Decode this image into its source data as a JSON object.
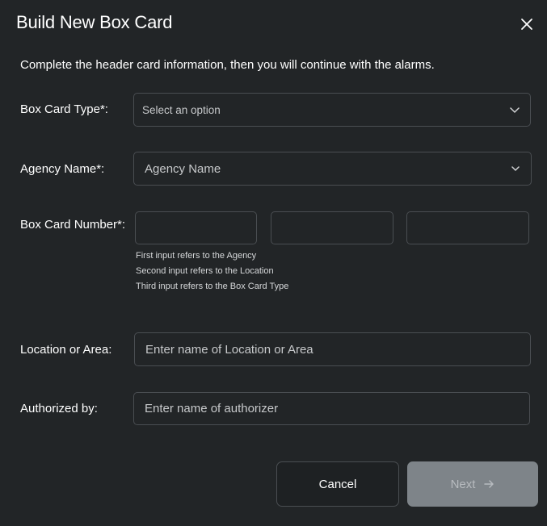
{
  "dialog": {
    "title": "Build New Box Card",
    "intro": "Complete the header card information, then you will continue with the alarms."
  },
  "form": {
    "box_card_type": {
      "label": "Box Card Type*:",
      "value": "Select an option"
    },
    "agency_name": {
      "label": "Agency Name*:",
      "value": "Agency Name"
    },
    "box_card_number": {
      "label": "Box Card Number*:",
      "hints": [
        "First input refers to the Agency",
        "Second input refers to the Location",
        "Third input refers to the Box Card Type"
      ]
    },
    "location": {
      "label": "Location or Area:",
      "placeholder": "Enter name of Location or Area"
    },
    "authorized_by": {
      "label": "Authorized by:",
      "placeholder": "Enter name of authorizer"
    }
  },
  "actions": {
    "cancel_label": "Cancel",
    "next_label": "Next"
  },
  "icons": {
    "close": "close-icon",
    "chevron": "chevron-down-icon",
    "arrow": "arrow-right-icon"
  }
}
